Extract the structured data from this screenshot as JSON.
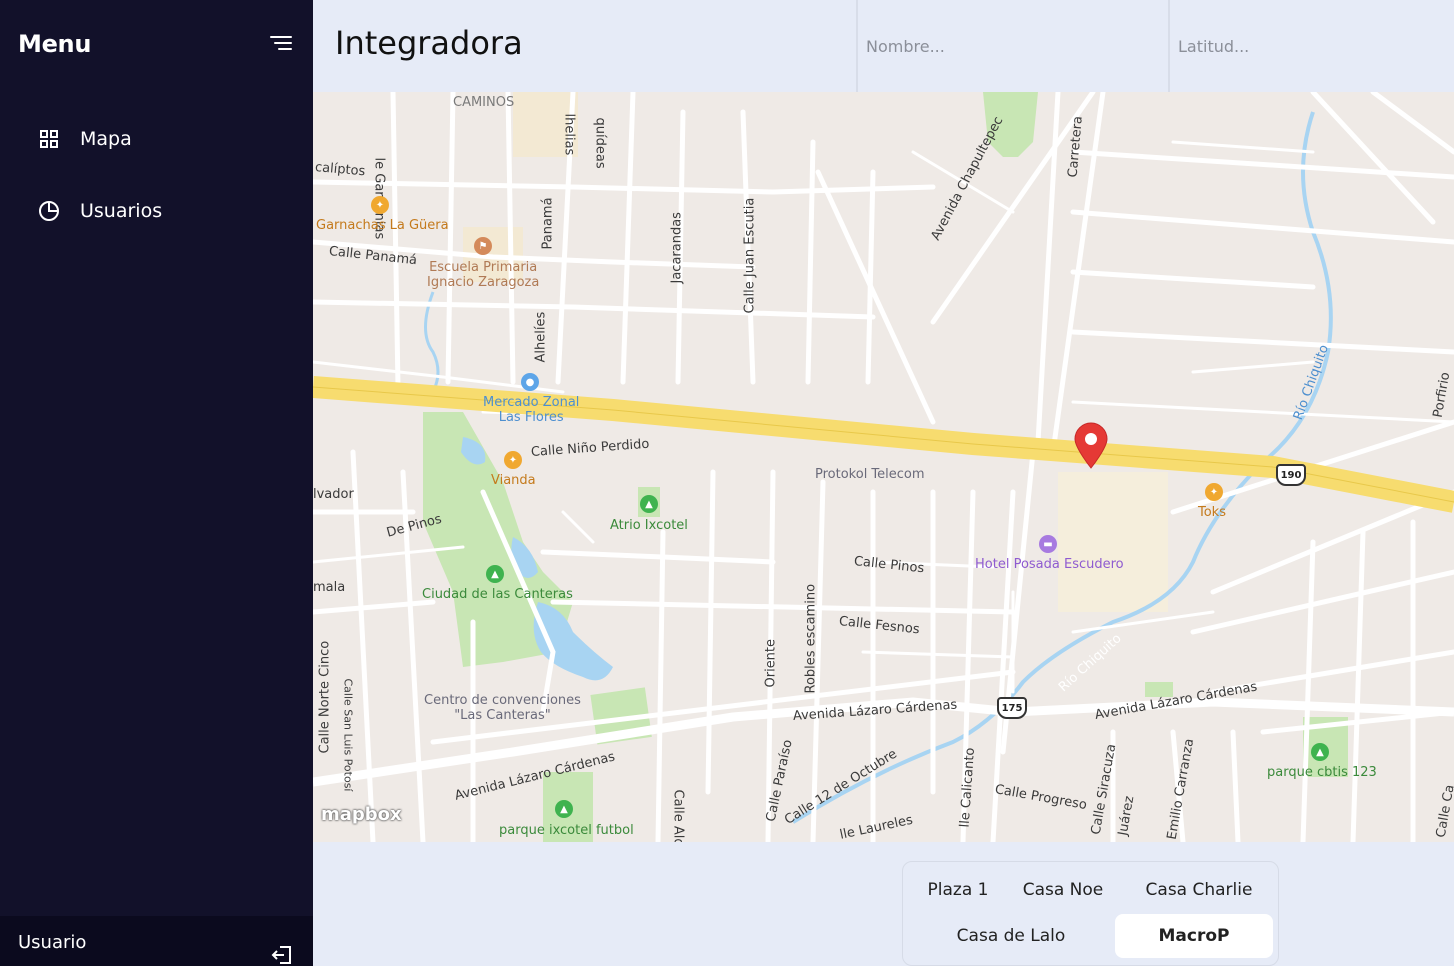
{
  "sidebar": {
    "title": "Menu",
    "items": [
      {
        "label": "Mapa",
        "icon": "grid-icon"
      },
      {
        "label": "Usuarios",
        "icon": "pie-chart-icon"
      }
    ],
    "footer_user": "Usuario"
  },
  "header": {
    "title": "Integradora",
    "name_placeholder": "Nombre...",
    "lat_placeholder": "Latitud..."
  },
  "map": {
    "attribution": "mapbox",
    "labels": {
      "caminos": "CAMINOS",
      "calle_gardenias": "le Gardenias",
      "calle_helias": "lhelias",
      "orquideas": "quídeas",
      "eucaliptos": "calíptos",
      "calle_panama": "Calle Panamá",
      "panama": "Panamá",
      "alhelies": "Alhelíes",
      "jacarandas": "Jacarandas",
      "juan_escutia": "Calle Juan Escutia",
      "chapultepec": "Avenida Chapultepec",
      "carretera": "Carretera",
      "nino_perdido": "Calle Niño Perdido",
      "salvador": "lvador",
      "de_pinos": "De Pinos",
      "mala": "mala",
      "calle_pinos": "Calle Pinos",
      "calle_fresnos": "Calle Fesnos",
      "robles": "Robles escamino",
      "oriente": "Oriente",
      "lazaro1": "Avenida Lázaro Cárdenas",
      "lazaro2": "Avenida Lázaro Cárdenas",
      "lazaro3": "Avenida Lázaro Cárdenas",
      "norte_cinco": "Calle Norte Cinco",
      "san_luis": "Calle San Luis Potosí",
      "paraiso": "Calle Paraíso",
      "doce_octubre": "Calle 12 de Octubre",
      "laureles": "lle Laureles",
      "calicanto": "lle Calicanto",
      "progreso": "Calle Progreso",
      "siracuza": "Calle Siracuza",
      "juarez": "Juárez",
      "carranza": "Emilio Carranza",
      "rio1": "Río Chiquito",
      "rio2": "Río Chiquito",
      "porfirio": "Porfirio",
      "calle_c": "Calle C",
      "calle_ca": "Calle Ca",
      "calle_ald": "Calle Ald"
    },
    "pois": {
      "garnachas": "Garnachas La Güera",
      "escuela": "Escuela Primaria\nIgnacio Zaragoza",
      "mercado": "Mercado Zonal\nLas Flores",
      "vianda": "Vianda",
      "atrio": "Atrio Ixcotel",
      "protokol": "Protokol Telecom",
      "toks": "Toks",
      "hotel": "Hotel Posada Escudero",
      "ciudad_canteras": "Ciudad de las Canteras",
      "centro_convenciones": "Centro de convenciones\n\"Las Canteras\"",
      "parque_ixcotel": "parque ixcotel futbol",
      "parque_cbtis": "parque cbtis 123"
    },
    "shields": [
      "190",
      "175"
    ]
  },
  "places": [
    {
      "label": "Plaza 1",
      "active": false
    },
    {
      "label": "Casa Noe",
      "active": false
    },
    {
      "label": "Casa Charlie",
      "active": false
    },
    {
      "label": "Casa de Lalo",
      "active": false
    },
    {
      "label": "MacroP",
      "active": true
    }
  ],
  "colors": {
    "sidebar_bg": "#12112a",
    "page_bg": "#e6ebf7",
    "highway": "#f7dc6f",
    "park": "#c8e6b4",
    "water": "#a8d4f2",
    "pin": "#e53935"
  }
}
